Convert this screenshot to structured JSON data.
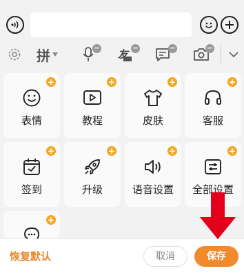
{
  "toolbar": {
    "pinyin_label": "拼"
  },
  "grid": {
    "items": [
      {
        "label": "表情"
      },
      {
        "label": "教程"
      },
      {
        "label": "皮肤"
      },
      {
        "label": "客服"
      },
      {
        "label": "签到"
      },
      {
        "label": "升级"
      },
      {
        "label": "语音设置"
      },
      {
        "label": "全部设置"
      },
      {
        "label": ""
      }
    ]
  },
  "bottom": {
    "restore_label": "恢复默认",
    "cancel_label": "取消",
    "save_label": "保存"
  },
  "colors": {
    "accent": "#f08a2c",
    "badge": "#f5a623",
    "arrow": "#e3001b"
  }
}
